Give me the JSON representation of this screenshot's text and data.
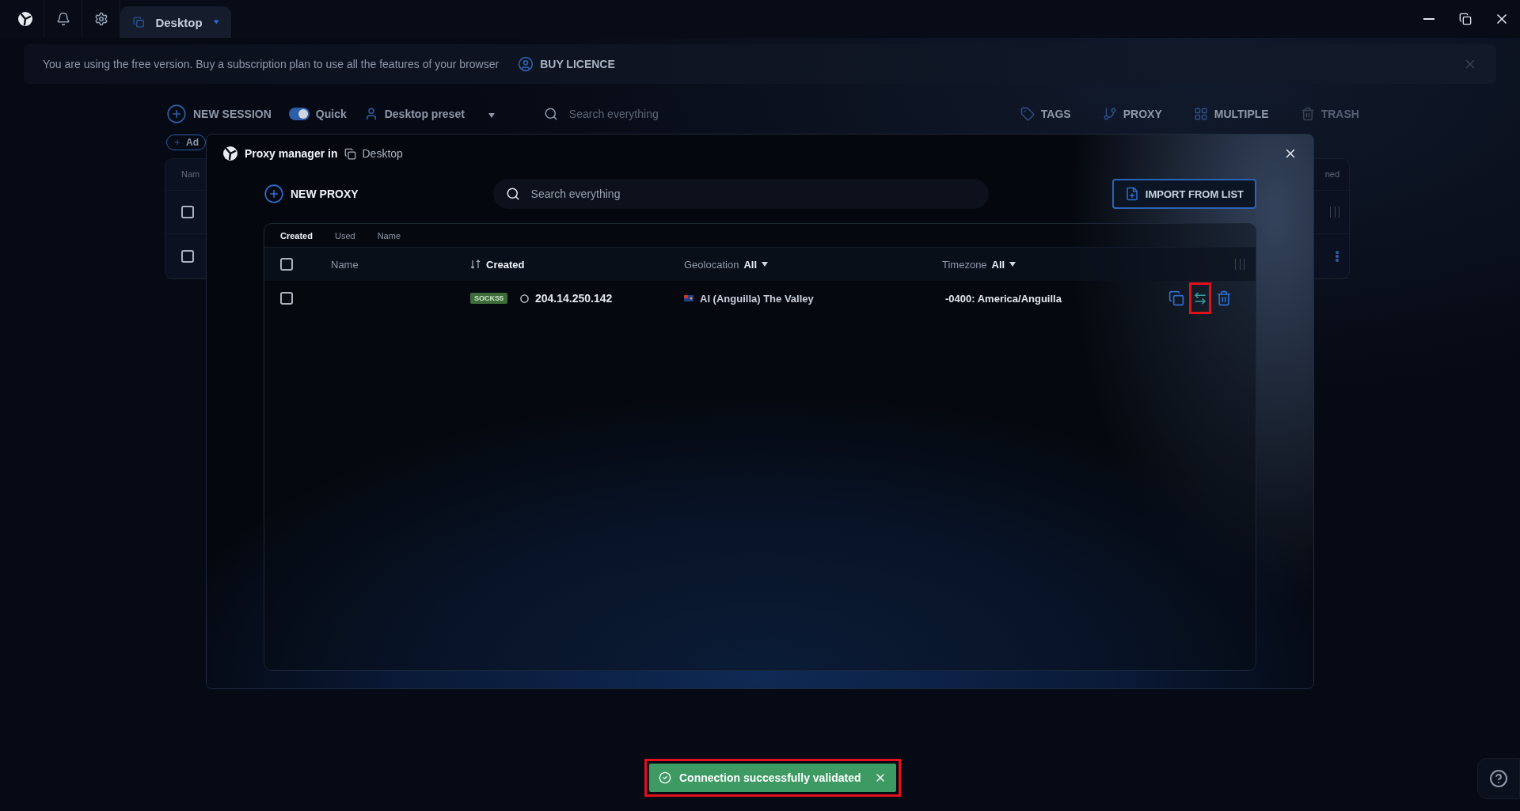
{
  "titlebar": {
    "tab": {
      "label": "Desktop",
      "selected": true
    }
  },
  "banner": {
    "text": "You are using the free version. Buy a subscription plan to use all the features of your browser",
    "action": "BUY LICENCE"
  },
  "toolbar": {
    "new_session": "NEW SESSION",
    "quick": {
      "label": "Quick",
      "on": true
    },
    "preset": "Desktop preset",
    "search": {
      "placeholder": "Search everything"
    },
    "actions": [
      {
        "label": "TAGS",
        "kind": "tags",
        "disabled": false
      },
      {
        "label": "PROXY",
        "kind": "proxy",
        "disabled": false
      },
      {
        "label": "MULTIPLE",
        "kind": "multiple",
        "disabled": false
      },
      {
        "label": "TRASH",
        "kind": "trash",
        "disabled": true
      }
    ]
  },
  "background_list": {
    "add_button": "Ad",
    "column_1": "Nam",
    "column_last": "ned",
    "rows": [
      {
        "checked": false
      },
      {
        "checked": false
      }
    ]
  },
  "modal": {
    "title": "Proxy manager in",
    "workspace": "Desktop",
    "new_proxy": "NEW PROXY",
    "search": {
      "placeholder": "Search everything"
    },
    "import": "IMPORT FROM LIST",
    "sort_tabs": [
      {
        "label": "Created",
        "selected": true
      },
      {
        "label": "Used",
        "selected": false
      },
      {
        "label": "Name",
        "selected": false
      }
    ],
    "columns": [
      {
        "label": "Name",
        "kind": "plain"
      },
      {
        "label": "Created",
        "kind": "sorted"
      },
      {
        "label": "Geolocation",
        "kind": "filter",
        "filter": "All"
      },
      {
        "label": "Timezone",
        "kind": "filter",
        "filter": "All"
      }
    ],
    "rows": [
      {
        "checked": false,
        "type": "SOCKS5",
        "host": "204.14.250.142",
        "geolocation": "AI (Anguilla) The Valley",
        "timezone": "-0400: America/Anguilla",
        "validate_highlighted": true
      }
    ],
    "select_all_checked": false
  },
  "toast": {
    "text": "Connection successfully validated",
    "highlighted": true
  }
}
